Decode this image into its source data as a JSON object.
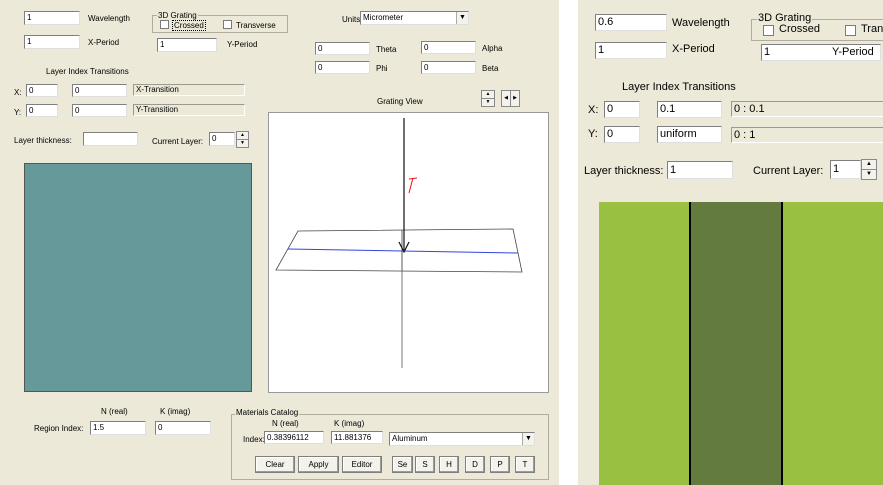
{
  "left": {
    "wavelength": {
      "value": "1",
      "label": "Wavelength"
    },
    "xperiod": {
      "value": "1",
      "label": "X-Period"
    },
    "grating3d": {
      "title": "3D Grating",
      "crossed": "Crossed",
      "transverse": "Transverse"
    },
    "yperiod": {
      "value": "1",
      "label": "Y-Period"
    },
    "units": {
      "label": "Units",
      "selected": "Micrometer"
    },
    "theta": {
      "value": "0",
      "label": "Theta"
    },
    "alpha": {
      "value": "0",
      "label": "Alpha"
    },
    "phi": {
      "value": "0",
      "label": "Phi"
    },
    "beta": {
      "value": "0",
      "label": "Beta"
    },
    "transitions": {
      "title": "Layer Index Transitions",
      "x_label": "X:",
      "x_a": "0",
      "x_b": "0",
      "x_result": "X-Transition",
      "y_label": "Y:",
      "y_a": "0",
      "y_b": "0",
      "y_result": "Y-Transition"
    },
    "grating_view": "Grating View",
    "thickness": {
      "label": "Layer thickness:",
      "value": ""
    },
    "current_layer": {
      "label": "Current Layer:",
      "value": "0"
    },
    "region": {
      "n_header": "N (real)",
      "k_header": "K (imag)",
      "label": "Region Index:",
      "n_value": "1.5",
      "k_value": "0"
    },
    "materials": {
      "title": "Materials Catalog",
      "n_header": "N (real)",
      "k_header": "K (imag)",
      "index_label": "Index:",
      "n_value": "0.38396112",
      "k_value": "11.881376",
      "material": "Aluminum",
      "buttons": [
        "Clear",
        "Apply",
        "Editor",
        "Se",
        "S",
        "H",
        "D",
        "P",
        "T"
      ]
    }
  },
  "right": {
    "wavelength": {
      "value": "0.6",
      "label": "Wavelength"
    },
    "xperiod": {
      "value": "1",
      "label": "X-Period"
    },
    "grating3d": {
      "title": "3D Grating",
      "crossed": "Crossed",
      "transverse": "Tran"
    },
    "yperiod": {
      "value": "1",
      "label": "Y-Period"
    },
    "transitions": {
      "title": "Layer Index Transitions",
      "x_label": "X:",
      "x_a": "0",
      "x_b": "0.1",
      "x_result": "0 : 0.1",
      "y_label": "Y:",
      "y_a": "0",
      "y_b": "uniform",
      "y_result": "0 : 1"
    },
    "thickness": {
      "label": "Layer thickness:",
      "value": "1"
    },
    "current_layer": {
      "label": "Current Layer:",
      "value": "1"
    }
  },
  "colors": {
    "panel_bg": "#ece9d8",
    "layer_preview_left": "#66999a",
    "stripe_light": "#9ac042",
    "stripe_dark": "#637b3f",
    "axis_blue": "#3344dd",
    "vector_red": "#ee1111"
  },
  "icons": [
    "up-down-spinner-icon",
    "left-right-spinner-icon",
    "dropdown-arrow-icon",
    "checkbox-icon"
  ]
}
